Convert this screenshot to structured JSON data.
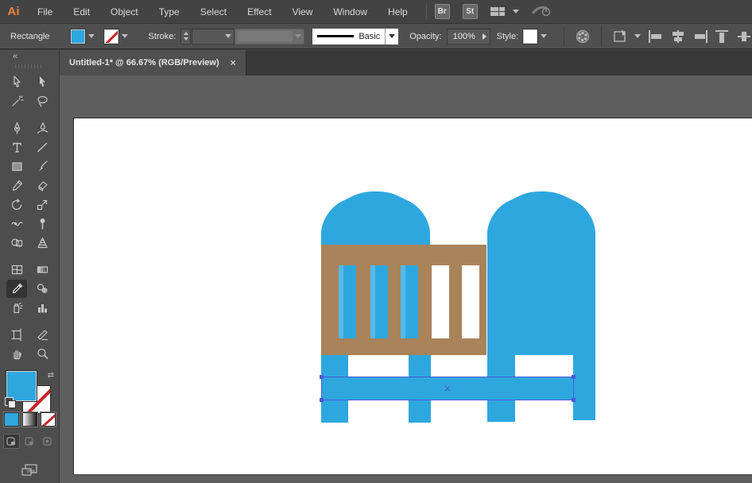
{
  "app": {
    "logo": "Ai"
  },
  "menubar": {
    "items": [
      "File",
      "Edit",
      "Object",
      "Type",
      "Select",
      "Effect",
      "View",
      "Window",
      "Help"
    ],
    "bridge_label": "Br",
    "stock_label": "St"
  },
  "control_bar": {
    "selection_type": "Rectangle",
    "stroke_label": "Stroke:",
    "stroke_style": "Basic",
    "opacity_label": "Opacity:",
    "opacity_value": "100%",
    "style_label": "Style:"
  },
  "document_tab": {
    "title": "Untitled-1* @ 66.67% (RGB/Preview)",
    "close_glyph": "×"
  },
  "toolbar": {
    "tools": [
      "selection",
      "direct-selection",
      "magic-wand",
      "lasso",
      "pen",
      "curvature",
      "type",
      "line-segment",
      "rectangle",
      "paintbrush",
      "pencil",
      "eraser",
      "rotate",
      "scale",
      "width",
      "free-transform",
      "shape-builder",
      "perspective-grid",
      "mesh",
      "gradient",
      "eyedropper",
      "blend",
      "symbol-sprayer",
      "column-graph",
      "artboard",
      "slice",
      "hand",
      "zoom"
    ],
    "active_tool": "eyedropper",
    "swap_glyph": "⇄"
  },
  "artwork": {
    "description": "baby crib icon, bottom rail rectangle selected",
    "colors": {
      "blue": "#2EA7DF",
      "light_blue": "#55B9E8",
      "brown": "#A9835A",
      "selection": "#4A5AD9",
      "white": "#FFFFFF"
    }
  }
}
